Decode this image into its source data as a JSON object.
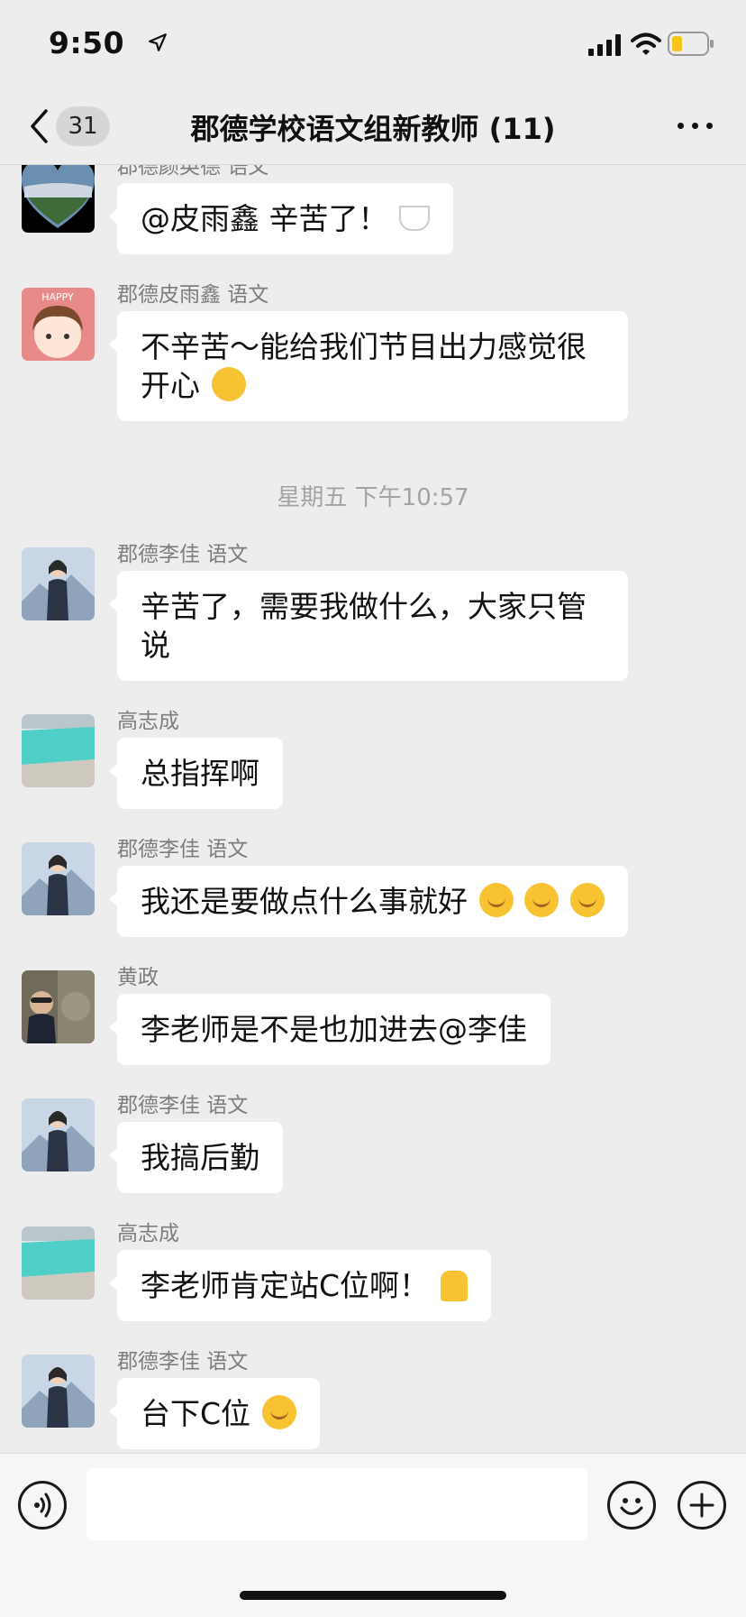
{
  "status_bar": {
    "time": "9:50"
  },
  "nav": {
    "unread_count": "31",
    "title": "郡德学校语文组新教师 (11)"
  },
  "messages": [
    {
      "sender": "郡德颜英德 语文",
      "text": "@皮雨鑫 辛苦了！",
      "emoji": "coffee-emoji",
      "avatar": "heart-landscape-avatar"
    },
    {
      "sender": "郡德皮雨鑫 语文",
      "text": "不辛苦～能给我们节目出力感觉很开心",
      "emoji": "party-face-emoji",
      "avatar": "happy-girl-avatar"
    },
    {
      "sender": "郡德李佳 语文",
      "text": "辛苦了，需要我做什么，大家只管说",
      "avatar": "teacher-woman-avatar"
    },
    {
      "sender": "高志成",
      "text": "总指挥啊",
      "avatar": "lake-landscape-avatar"
    },
    {
      "sender": "郡德李佳 语文",
      "text": "我还是要做点什么事就好",
      "emoji": "thinking-face-emoji x3",
      "avatar": "teacher-woman-avatar"
    },
    {
      "sender": "黄政",
      "text": "李老师是不是也加进去@李佳",
      "avatar": "man-statue-avatar"
    },
    {
      "sender": "郡德李佳 语文",
      "text": "我搞后勤",
      "avatar": "teacher-woman-avatar"
    },
    {
      "sender": "高志成",
      "text": "李老师肯定站C位啊！",
      "emoji": "thumbs-up-emoji",
      "avatar": "lake-landscape-avatar"
    },
    {
      "sender": "郡德李佳 语文",
      "text": "台下C位",
      "emoji": "thinking-face-emoji",
      "avatar": "teacher-woman-avatar"
    }
  ],
  "time_divider": "星期五 下午10:57",
  "input": {
    "placeholder": ""
  },
  "colors": {
    "background": "#ededed",
    "bubble": "#ffffff",
    "sender_text": "#7d7d7d",
    "divider_text": "#a3a3a3"
  }
}
